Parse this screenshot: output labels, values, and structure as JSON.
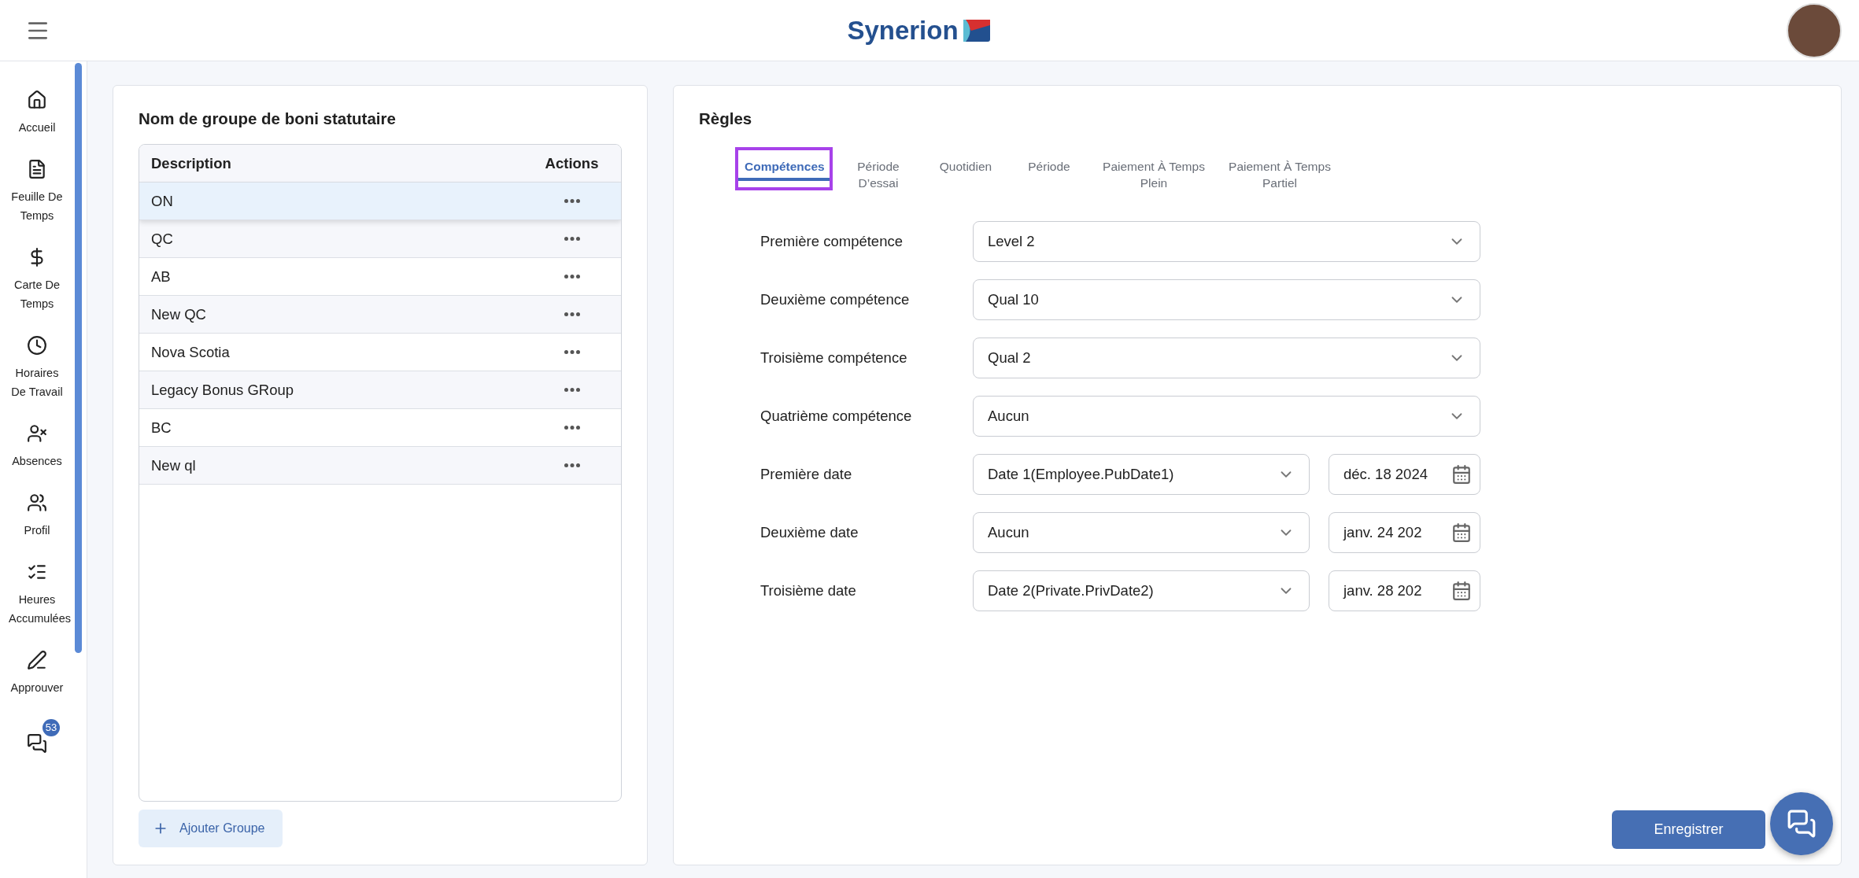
{
  "header": {
    "logo": "Synerion"
  },
  "sidebar": {
    "items": [
      {
        "label": "Accueil"
      },
      {
        "label": "Feuille De Temps"
      },
      {
        "label": "Carte De Temps"
      },
      {
        "label": "Horaires De Travail"
      },
      {
        "label": "Absences"
      },
      {
        "label": "Profil"
      },
      {
        "label": "Heures Accumulées"
      },
      {
        "label": "Approuver"
      },
      {
        "badge": "53"
      }
    ]
  },
  "groups_panel": {
    "title": "Nom de groupe de boni statutaire",
    "table": {
      "columns": [
        "Description",
        "Actions"
      ],
      "rows": [
        {
          "description": "ON",
          "selected": true
        },
        {
          "description": "QC",
          "selected": false
        },
        {
          "description": "AB",
          "selected": false
        },
        {
          "description": "New QC",
          "selected": false
        },
        {
          "description": "Nova Scotia",
          "selected": false
        },
        {
          "description": "Legacy Bonus GRoup",
          "selected": false
        },
        {
          "description": "BC",
          "selected": false
        },
        {
          "description": "New ql",
          "selected": false
        }
      ]
    },
    "add_button": "Ajouter Groupe"
  },
  "rules_panel": {
    "title": "Règles",
    "tabs": [
      {
        "label": "Compétences",
        "selected": true,
        "highlighted": true
      },
      {
        "label": "Période D’essai",
        "selected": false,
        "highlighted": false
      },
      {
        "label": "Quotidien",
        "selected": false,
        "highlighted": false
      },
      {
        "label": "Période",
        "selected": false,
        "highlighted": false
      },
      {
        "label": "Paiement À Temps Plein",
        "selected": false,
        "highlighted": false
      },
      {
        "label": "Paiement À Temps Partiel",
        "selected": false,
        "highlighted": false
      }
    ],
    "fields": [
      {
        "kind": "select",
        "label": "Première compétence",
        "value": "Level 2"
      },
      {
        "kind": "select",
        "label": "Deuxième compétence",
        "value": "Qual 10"
      },
      {
        "kind": "select",
        "label": "Troisième compétence",
        "value": "Qual 2"
      },
      {
        "kind": "select",
        "label": "Quatrième compétence",
        "value": "Aucun"
      },
      {
        "kind": "date",
        "label": "Première date",
        "value": "Date 1(Employee.PubDate1)",
        "date": "déc. 18 2024"
      },
      {
        "kind": "date",
        "label": "Deuxième date",
        "value": "Aucun",
        "date": "janv. 24 202"
      },
      {
        "kind": "date",
        "label": "Troisième date",
        "value": "Date 2(Private.PrivDate2)",
        "date": "janv. 28 202"
      }
    ],
    "save_button": "Enregistrer"
  }
}
